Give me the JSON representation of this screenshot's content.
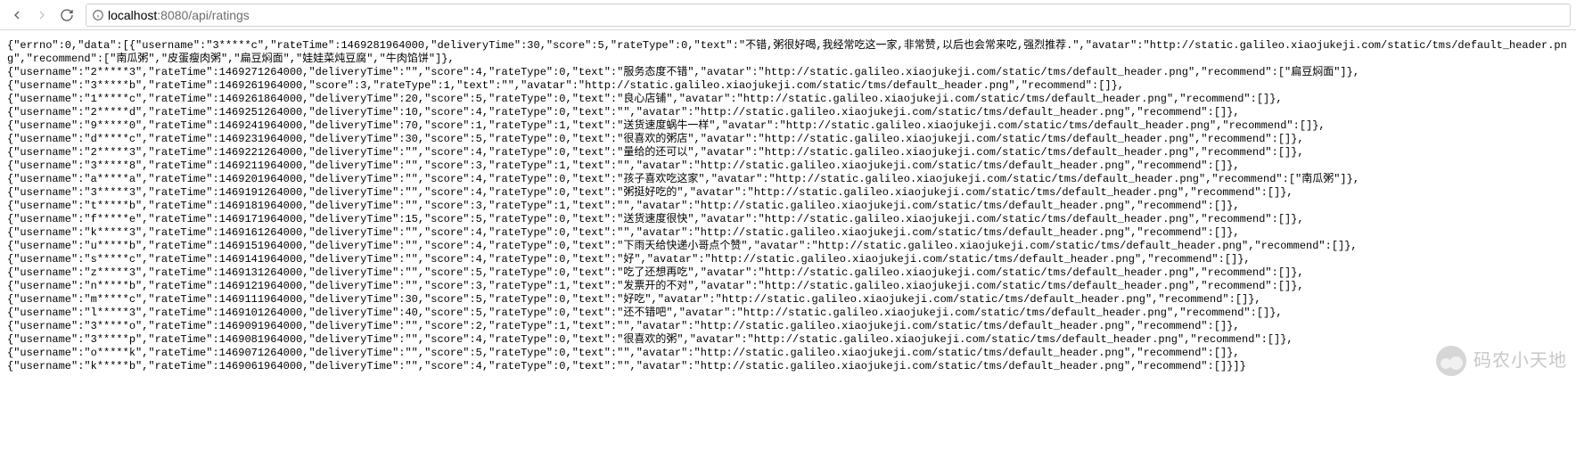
{
  "url": {
    "host": "localhost",
    "rest": ":8080/api/ratings"
  },
  "avatar_url": "http://static.galileo.xiaojukeji.com/static/tms/default_header.png",
  "first_wrap": {
    "prefix": "{\"errno\":0,\"data\":[",
    "suffix": ","
  },
  "ratings": [
    {
      "username": "3*****c",
      "rateTime": 1469281964000,
      "deliveryTime": 30,
      "score": 5,
      "rateType": 0,
      "text": "不错,粥很好喝,我经常吃这一家,非常赞,以后也会常来吃,强烈推荐.",
      "recommend": [
        "南瓜粥",
        "皮蛋瘦肉粥",
        "扁豆焖面",
        "娃娃菜炖豆腐",
        "牛肉馅饼"
      ]
    },
    {
      "username": "2*****3",
      "rateTime": 1469271264000,
      "deliveryTime": "",
      "score": 4,
      "rateType": 0,
      "text": "服务态度不错",
      "recommend": [
        "扁豆焖面"
      ]
    },
    {
      "username": "3*****b",
      "rateTime": 1469261964000,
      "score": 3,
      "rateType": 1,
      "text": "",
      "recommend": []
    },
    {
      "username": "1*****c",
      "rateTime": 1469261864000,
      "deliveryTime": 20,
      "score": 5,
      "rateType": 0,
      "text": "良心店铺",
      "recommend": []
    },
    {
      "username": "2*****d",
      "rateTime": 1469251264000,
      "deliveryTime": 10,
      "score": 4,
      "rateType": 0,
      "text": "",
      "recommend": []
    },
    {
      "username": "9*****0",
      "rateTime": 1469241964000,
      "deliveryTime": 70,
      "score": 1,
      "rateType": 1,
      "text": "送货速度蜗牛一样",
      "recommend": []
    },
    {
      "username": "d*****c",
      "rateTime": 1469231964000,
      "deliveryTime": 30,
      "score": 5,
      "rateType": 0,
      "text": "很喜欢的粥店",
      "recommend": []
    },
    {
      "username": "2*****3",
      "rateTime": 1469221264000,
      "deliveryTime": "",
      "score": 4,
      "rateType": 0,
      "text": "量给的还可以",
      "recommend": []
    },
    {
      "username": "3*****8",
      "rateTime": 1469211964000,
      "deliveryTime": "",
      "score": 3,
      "rateType": 1,
      "text": "",
      "recommend": []
    },
    {
      "username": "a*****a",
      "rateTime": 1469201964000,
      "deliveryTime": "",
      "score": 4,
      "rateType": 0,
      "text": "孩子喜欢吃这家",
      "recommend": [
        "南瓜粥"
      ]
    },
    {
      "username": "3*****3",
      "rateTime": 1469191264000,
      "deliveryTime": "",
      "score": 4,
      "rateType": 0,
      "text": "粥挺好吃的",
      "recommend": []
    },
    {
      "username": "t*****b",
      "rateTime": 1469181964000,
      "deliveryTime": "",
      "score": 3,
      "rateType": 1,
      "text": "",
      "recommend": []
    },
    {
      "username": "f*****e",
      "rateTime": 1469171964000,
      "deliveryTime": 15,
      "score": 5,
      "rateType": 0,
      "text": "送货速度很快",
      "recommend": []
    },
    {
      "username": "k*****3",
      "rateTime": 1469161264000,
      "deliveryTime": "",
      "score": 4,
      "rateType": 0,
      "text": "",
      "recommend": []
    },
    {
      "username": "u*****b",
      "rateTime": 1469151964000,
      "deliveryTime": "",
      "score": 4,
      "rateType": 0,
      "text": "下雨天给快递小哥点个赞",
      "recommend": []
    },
    {
      "username": "s*****c",
      "rateTime": 1469141964000,
      "deliveryTime": "",
      "score": 4,
      "rateType": 0,
      "text": "好",
      "recommend": []
    },
    {
      "username": "z*****3",
      "rateTime": 1469131264000,
      "deliveryTime": "",
      "score": 5,
      "rateType": 0,
      "text": "吃了还想再吃",
      "recommend": []
    },
    {
      "username": "n*****b",
      "rateTime": 1469121964000,
      "deliveryTime": "",
      "score": 3,
      "rateType": 1,
      "text": "发票开的不对",
      "recommend": []
    },
    {
      "username": "m*****c",
      "rateTime": 1469111964000,
      "deliveryTime": 30,
      "score": 5,
      "rateType": 0,
      "text": "好吃",
      "recommend": []
    },
    {
      "username": "l*****3",
      "rateTime": 1469101264000,
      "deliveryTime": 40,
      "score": 5,
      "rateType": 0,
      "text": "还不错吧",
      "recommend": []
    },
    {
      "username": "3*****o",
      "rateTime": 1469091964000,
      "deliveryTime": "",
      "score": 2,
      "rateType": 1,
      "text": "",
      "recommend": []
    },
    {
      "username": "3*****p",
      "rateTime": 1469081964000,
      "deliveryTime": "",
      "score": 4,
      "rateType": 0,
      "text": "很喜欢的粥",
      "recommend": []
    },
    {
      "username": "o*****k",
      "rateTime": 1469071264000,
      "deliveryTime": "",
      "score": 5,
      "rateType": 0,
      "text": "",
      "recommend": []
    },
    {
      "username": "k*****b",
      "rateTime": 1469061964000,
      "deliveryTime": "",
      "score": 4,
      "rateType": 0,
      "text": "",
      "recommend": []
    }
  ],
  "close_suffix": "]}",
  "watermark_text": "码农小天地"
}
